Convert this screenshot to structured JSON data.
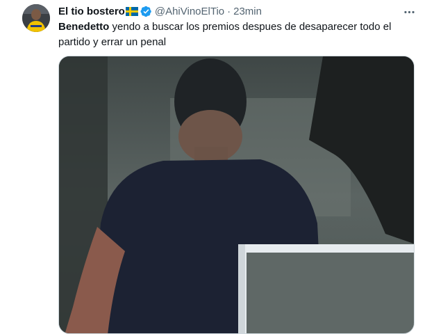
{
  "tweet": {
    "author": {
      "display_name": "El tio bostero",
      "flag_icon": "sweden-flag-icon",
      "verified_icon": "verified-badge-icon",
      "handle": "@AhiVinoElTio",
      "separator": "·",
      "time": "23min",
      "avatar_icon": "avatar-icon"
    },
    "more_icon": "more-options-icon",
    "text": {
      "mention": "Benedetto",
      "body": " yendo a buscar los premios despues de desaparecer todo el partido y errar un penal"
    },
    "media": {
      "type": "video",
      "icon": "video-media-icon"
    },
    "colors": {
      "verified": "#1d9bf0",
      "secondary_text": "#536471",
      "primary_text": "#0f1419"
    }
  }
}
